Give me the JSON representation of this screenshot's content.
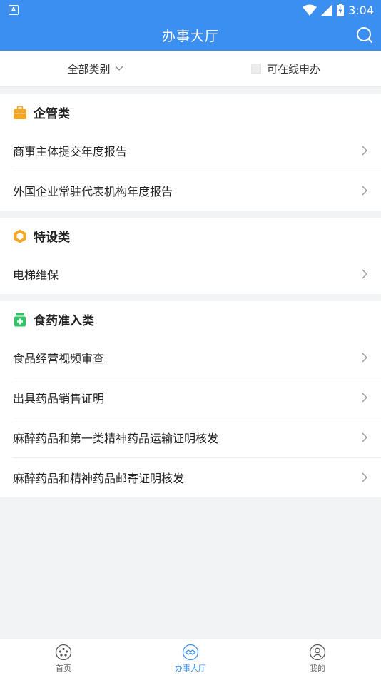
{
  "statusbar": {
    "app_icon_letter": "A",
    "time": "3:04"
  },
  "header": {
    "title": "办事大厅",
    "search_icon": "search-icon"
  },
  "filters": {
    "category_label": "全部类别",
    "online_label": "可在线申办"
  },
  "sections": [
    {
      "title": "企管类",
      "icon": "briefcase-icon",
      "items": [
        "商事主体提交年度报告",
        "外国企业常驻代表机构年度报告"
      ]
    },
    {
      "title": "特设类",
      "icon": "hexagon-icon",
      "items": [
        "电梯维保"
      ]
    },
    {
      "title": "食药准入类",
      "icon": "medicine-bottle-icon",
      "items": [
        "食品经营视频审查",
        "出具药品销售证明",
        "麻醉药品和第一类精神药品运输证明核发",
        "麻醉药品和精神药品邮寄证明核发"
      ]
    }
  ],
  "tabs": [
    {
      "label": "首页",
      "icon": "home-icon",
      "active": false
    },
    {
      "label": "办事大厅",
      "icon": "handshake-icon",
      "active": true
    },
    {
      "label": "我的",
      "icon": "user-icon",
      "active": false
    }
  ],
  "colors": {
    "brand": "#3b8ff0",
    "briefcase": "#f5a623",
    "hexagon": "#f5a623",
    "medicine": "#35c168"
  }
}
